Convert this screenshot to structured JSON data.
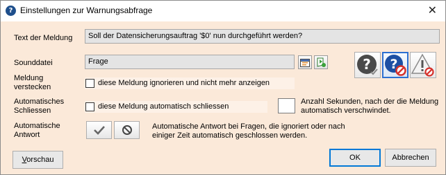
{
  "window": {
    "title": "Einstellungen zur Warnungsabfrage",
    "close_glyph": "✕"
  },
  "message": {
    "label": "Text der Meldung",
    "value": "Soll der Datensicherungsauftrag '$0' nun durchgeführt werden?"
  },
  "sound": {
    "label": "Sounddatei",
    "value": "Frage",
    "browse_icon": "folder-browse-icon",
    "play_icon": "play-sound-icon"
  },
  "icon_choices": [
    {
      "name": "question-mark-icon",
      "selected": false
    },
    {
      "name": "question-mark-blocked-icon",
      "selected": true
    },
    {
      "name": "warning-blocked-icon",
      "selected": false
    }
  ],
  "hide": {
    "label_line1": "Meldung",
    "label_line2": "verstecken",
    "checkbox_label": "diese Meldung ignorieren und nicht mehr anzeigen",
    "checked": false
  },
  "auto_close": {
    "label_line1": "Automatisches",
    "label_line2": "Schliessen",
    "checkbox_label": "diese Meldung automatisch schliessen",
    "checked": false,
    "seconds_value": "",
    "hint_line1": "Anzahl Sekunden, nach der die Meldung",
    "hint_line2": "automatisch verschwindet."
  },
  "auto_answer": {
    "label_line1": "Automatische",
    "label_line2": "Antwort",
    "hint_line1": "Automatische Antwort bei Fragen, die ignoriert oder nach",
    "hint_line2": "einiger Zeit automatisch geschlossen werden.",
    "yes_icon": "checkmark-icon",
    "no_icon": "no-entry-icon"
  },
  "buttons": {
    "preview_prefix": "",
    "preview_underlined": "V",
    "preview_rest": "orschau",
    "ok": "OK",
    "cancel": "Abbrechen"
  },
  "colors": {
    "dialog_background": "#fbe9d9",
    "field_background": "#e4e4e4",
    "checkbox_row_background": "#fdf1e7",
    "selected_border": "#2b6fd1",
    "default_button_border": "#0078d7",
    "blocked_red": "#d6322c",
    "question_gray": "#4a4a4a",
    "question_blue": "#1c4fa3"
  }
}
